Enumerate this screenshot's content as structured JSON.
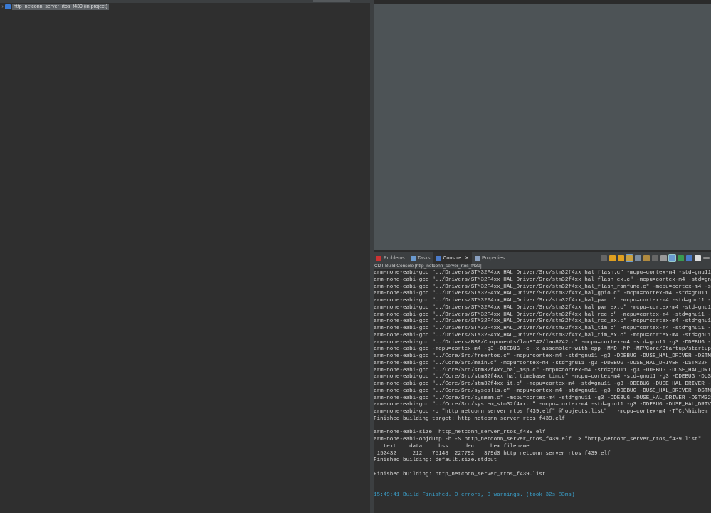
{
  "project_explorer": {
    "project_label": "http_netconn_server_rtos_f439 (in project)"
  },
  "console_view": {
    "tabs": [
      {
        "label": "Problems"
      },
      {
        "label": "Tasks"
      },
      {
        "label": "Console"
      },
      {
        "label": "Properties"
      }
    ],
    "title": "CDT Build Console [http_netconn_server_rtos_f439]",
    "lines": [
      "arm-none-eabi-gcc \"../Drivers/STM32F4xx_HAL_Driver/Src/stm32f4xx_hal_flash.c\" -mcpu=cortex-m4 -std=gnu11",
      "arm-none-eabi-gcc \"../Drivers/STM32F4xx_HAL_Driver/Src/stm32f4xx_hal_flash_ex.c\" -mcpu=cortex-m4 -std=gnu11",
      "arm-none-eabi-gcc \"../Drivers/STM32F4xx_HAL_Driver/Src/stm32f4xx_hal_flash_ramfunc.c\" -mcpu=cortex-m4 -std=gnu11",
      "arm-none-eabi-gcc \"../Drivers/STM32F4xx_HAL_Driver/Src/stm32f4xx_hal_gpio.c\" -mcpu=cortex-m4 -std=gnu11",
      "arm-none-eabi-gcc \"../Drivers/STM32F4xx_HAL_Driver/Src/stm32f4xx_hal_pwr.c\" -mcpu=cortex-m4 -std=gnu11 -g3",
      "arm-none-eabi-gcc \"../Drivers/STM32F4xx_HAL_Driver/Src/stm32f4xx_hal_pwr_ex.c\" -mcpu=cortex-m4 -std=gnu11",
      "arm-none-eabi-gcc \"../Drivers/STM32F4xx_HAL_Driver/Src/stm32f4xx_hal_rcc.c\" -mcpu=cortex-m4 -std=gnu11 -g3",
      "arm-none-eabi-gcc \"../Drivers/STM32F4xx_HAL_Driver/Src/stm32f4xx_hal_rcc_ex.c\" -mcpu=cortex-m4 -std=gnu11",
      "arm-none-eabi-gcc \"../Drivers/STM32F4xx_HAL_Driver/Src/stm32f4xx_hal_tim.c\" -mcpu=cortex-m4 -std=gnu11 -g3",
      "arm-none-eabi-gcc \"../Drivers/STM32F4xx_HAL_Driver/Src/stm32f4xx_hal_tim_ex.c\" -mcpu=cortex-m4 -std=gnu11",
      "arm-none-eabi-gcc \"../Drivers/BSP/Components/lan8742/lan8742.c\" -mcpu=cortex-m4 -std=gnu11 -g3 -DDEBUG -",
      "arm-none-eabi-gcc -mcpu=cortex-m4 -g3 -DDEBUG -c -x assembler-with-cpp -MMD -MP -MF\"Core/Startup/startup",
      "arm-none-eabi-gcc \"../Core/Src/freertos.c\" -mcpu=cortex-m4 -std=gnu11 -g3 -DDEBUG -DUSE_HAL_DRIVER -DSTM",
      "arm-none-eabi-gcc \"../Core/Src/main.c\" -mcpu=cortex-m4 -std=gnu11 -g3 -DDEBUG -DUSE_HAL_DRIVER -DSTM32F",
      "arm-none-eabi-gcc \"../Core/Src/stm32f4xx_hal_msp.c\" -mcpu=cortex-m4 -std=gnu11 -g3 -DDEBUG -DUSE_HAL_DRI",
      "arm-none-eabi-gcc \"../Core/Src/stm32f4xx_hal_timebase_tim.c\" -mcpu=cortex-m4 -std=gnu11 -g3 -DDEBUG -DUS",
      "arm-none-eabi-gcc \"../Core/Src/stm32f4xx_it.c\" -mcpu=cortex-m4 -std=gnu11 -g3 -DDEBUG -DUSE_HAL_DRIVER -",
      "arm-none-eabi-gcc \"../Core/Src/syscalls.c\" -mcpu=cortex-m4 -std=gnu11 -g3 -DDEBUG -DUSE_HAL_DRIVER -DSTM",
      "arm-none-eabi-gcc \"../Core/Src/sysmem.c\" -mcpu=cortex-m4 -std=gnu11 -g3 -DDEBUG -DUSE_HAL_DRIVER -DSTM32",
      "arm-none-eabi-gcc \"../Core/Src/system_stm32f4xx.c\" -mcpu=cortex-m4 -std=gnu11 -g3 -DDEBUG -DUSE_HAL_DRIV",
      "arm-none-eabi-gcc -o \"http_netconn_server_rtos_f439.elf\" @\"objects.list\"   -mcpu=cortex-m4 -T\"C:\\hichem",
      "Finished building target: http_netconn_server_rtos_f439.elf",
      "",
      "arm-none-eabi-size  http_netconn_server_rtos_f439.elf",
      "arm-none-eabi-objdump -h -S http_netconn_server_rtos_f439.elf  > \"http_netconn_server_rtos_f439.list\"",
      "   text    data     bss     dec     hex filename",
      " 152432     212   75148  227792   379d0 http_netconn_server_rtos_f439.elf",
      "Finished building: default.size.stdout",
      "",
      "Finished building: http_netconn_server_rtos_f439.list",
      "",
      ""
    ],
    "status_line": "15:49:41 Build Finished. 0 errors, 0 warnings. (took 32s.83ms)",
    "colors": {
      "status": "#3a9fc9",
      "background": "#2f2f2f"
    }
  }
}
